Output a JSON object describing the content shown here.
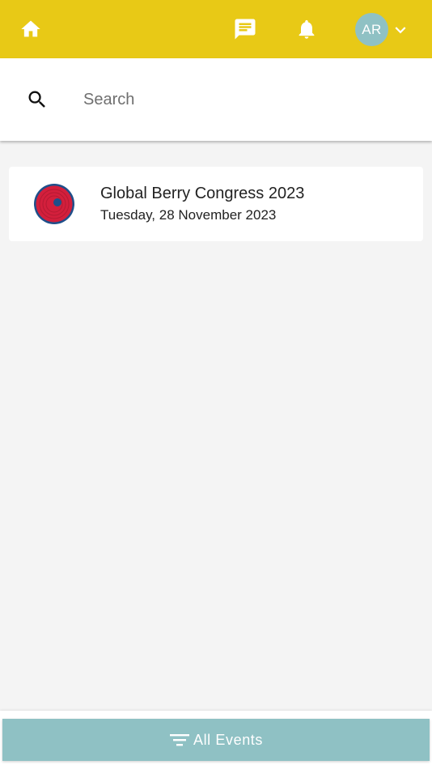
{
  "topbar": {
    "background": "#e8c916",
    "icons": [
      "home-icon",
      "chat-icon",
      "bell-icon",
      "chevron-down-icon"
    ],
    "avatar_initials": "AR",
    "avatar_color": "#8fc1c4"
  },
  "search": {
    "placeholder": "Search",
    "value": ""
  },
  "events": [
    {
      "title": "Global Berry Congress 2023",
      "date": "Tuesday, 28 November 2023",
      "logo": "target-logo-icon"
    }
  ],
  "bottom": {
    "button_label": "All Events",
    "button_icon": "filter-icon",
    "button_color": "#8fc1c4"
  }
}
